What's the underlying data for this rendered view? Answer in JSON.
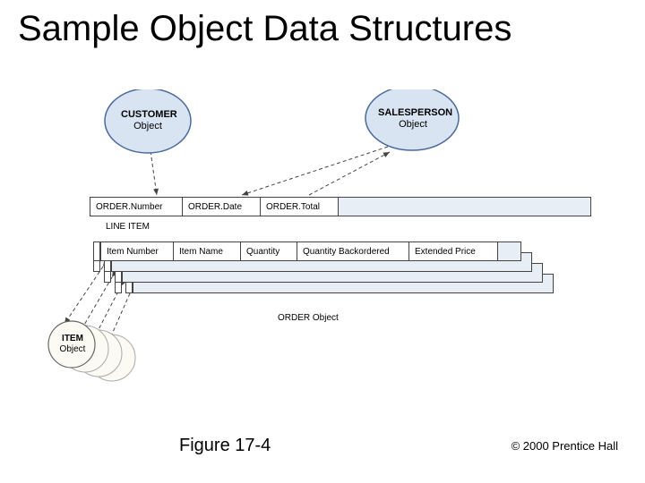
{
  "title": "Sample Object Data Structures",
  "objects": {
    "customer": {
      "line1": "CUSTOMER",
      "line2": "Object"
    },
    "salesperson": {
      "line1": "SALESPERSON",
      "line2": "Object"
    },
    "item": {
      "line1": "ITEM",
      "line2": "Object"
    }
  },
  "order_fields": [
    "ORDER.Number",
    "ORDER.Date",
    "ORDER.Total"
  ],
  "lineitem_label": "LINE ITEM",
  "lineitem_fields": [
    "Item Number",
    "Item Name",
    "Quantity",
    "Quantity Backordered",
    "Extended Price"
  ],
  "order_object_label": "ORDER Object",
  "figure": "Figure 17-4",
  "copyright": "© 2000 Prentice Hall"
}
